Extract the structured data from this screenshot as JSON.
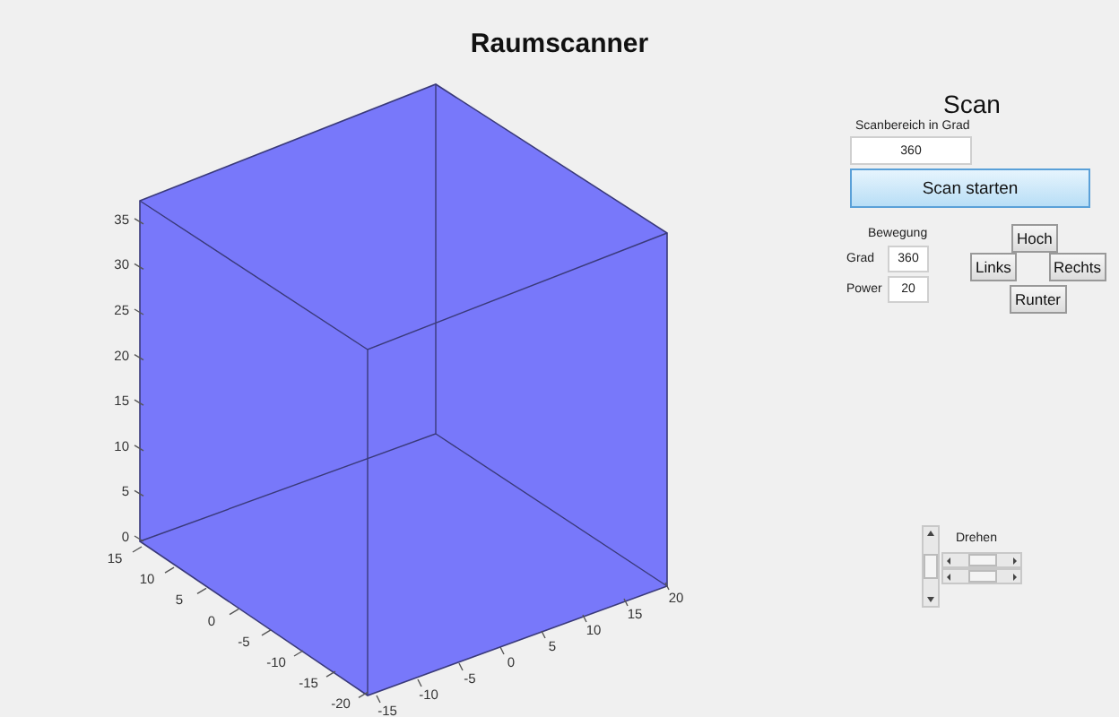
{
  "title": "Raumscanner",
  "plot": {
    "z_ticks": [
      "35",
      "30",
      "25",
      "20",
      "15",
      "10",
      "5",
      "0"
    ],
    "y_ticks": [
      "15",
      "10",
      "5",
      "0",
      "-5",
      "-10",
      "-15",
      "-20"
    ],
    "x_ticks": [
      "-15",
      "-10",
      "-5",
      "0",
      "5",
      "10",
      "15",
      "20"
    ]
  },
  "scan": {
    "heading": "Scan",
    "range_label": "Scanbereich in Grad",
    "range_value": "360",
    "start_button": "Scan starten"
  },
  "movement": {
    "heading": "Bewegung",
    "fields": [
      {
        "label": "Grad",
        "value": "360"
      },
      {
        "label": "Power",
        "value": "20"
      }
    ],
    "buttons": {
      "up": "Hoch",
      "left": "Links",
      "right": "Rechts",
      "down": "Runter"
    }
  },
  "rotate": {
    "label": "Drehen",
    "vertical_slider": {
      "level": 0.5
    },
    "sliders": [
      {
        "level": 0.5
      },
      {
        "level": 0.5
      }
    ]
  }
}
